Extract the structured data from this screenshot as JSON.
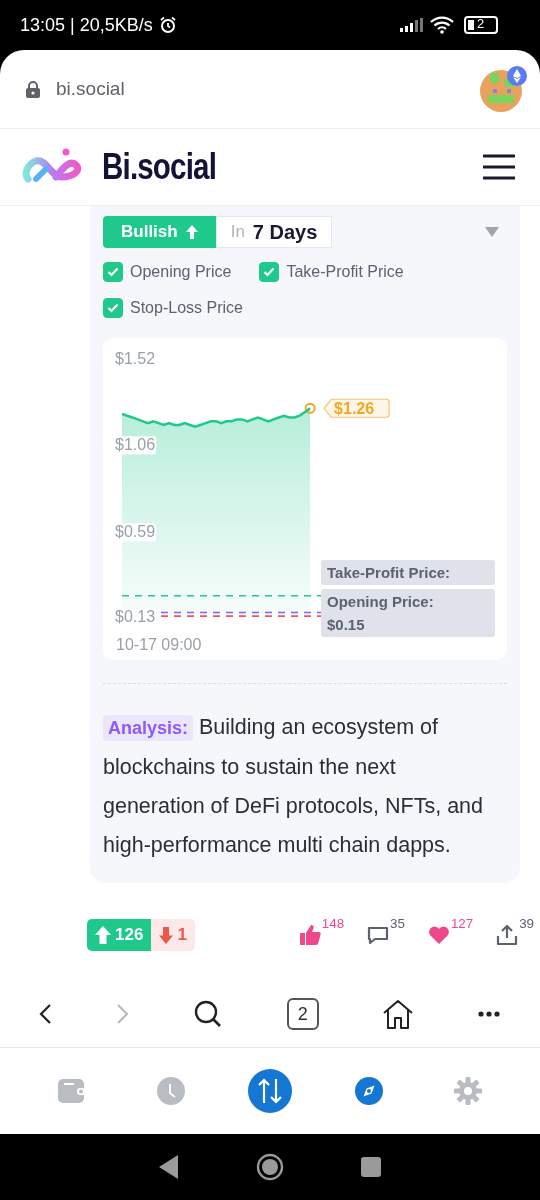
{
  "status_bar": {
    "time": "13:05 | 20,5KB/s",
    "battery": "2"
  },
  "address_bar": {
    "url": "bi.social"
  },
  "site_header": {
    "logo": "Bi.social"
  },
  "prediction": {
    "direction": "Bullish",
    "period_prefix": "In",
    "period": "7 Days"
  },
  "toggles": [
    {
      "label": "Opening Price",
      "checked": true
    },
    {
      "label": "Take-Profit Price",
      "checked": true
    },
    {
      "label": "Stop-Loss Price",
      "checked": true
    }
  ],
  "chart": {
    "chart_data": {
      "type": "area",
      "ylim": [
        0.13,
        1.52
      ],
      "yticks": [
        {
          "value": 1.52,
          "label": "$1.52"
        },
        {
          "value": 1.06,
          "label": "$1.06"
        },
        {
          "value": 0.59,
          "label": "$0.59"
        },
        {
          "value": 0.13,
          "label": "$0.13"
        }
      ],
      "series": [
        {
          "color": "#1ec98b",
          "values": [
            1.23,
            1.22,
            1.21,
            1.2,
            1.19,
            1.18,
            1.19,
            1.18,
            1.17,
            1.18,
            1.17,
            1.17,
            1.18,
            1.17,
            1.16,
            1.17,
            1.18,
            1.19,
            1.19,
            1.18,
            1.19,
            1.19,
            1.2,
            1.2,
            1.19,
            1.2,
            1.21,
            1.2,
            1.19,
            1.2,
            1.21,
            1.22,
            1.21,
            1.21,
            1.22,
            1.24,
            1.26,
            null,
            null,
            null,
            null,
            null,
            null,
            null,
            null,
            null,
            null,
            null,
            null,
            null,
            null,
            null,
            null,
            null,
            null,
            null,
            null,
            null,
            null,
            null,
            null,
            null,
            null,
            null,
            null,
            null,
            null,
            null,
            null,
            null,
            null,
            null
          ]
        }
      ],
      "ref_lines": [
        {
          "axis": "y",
          "value": 0.25,
          "color": "#1ec98b"
        },
        {
          "axis": "y",
          "value": 0.16,
          "color": "#8b5cf6"
        },
        {
          "axis": "y",
          "value": 0.14,
          "color": "#f0556a"
        }
      ]
    },
    "start_time": "10-17 09:00",
    "current_price": "$1.26",
    "tooltips": [
      {
        "title": "Take-Profit Price:"
      },
      {
        "title": "Opening Price:",
        "value": "$0.15"
      }
    ]
  },
  "analysis": {
    "tag": "Analysis:",
    "text": "Building an ecosystem of blockchains to sustain the next generation of DeFi protocols, NFTs, and high-performance multi chain dapps."
  },
  "votes": {
    "up": "126",
    "down": "1"
  },
  "stats": [
    {
      "count": "148",
      "active": true
    },
    {
      "count": "35",
      "active": false
    },
    {
      "count": "127",
      "active": true
    },
    {
      "count": "39",
      "active": false
    }
  ],
  "browser_toolbar": {
    "tab_count": "2",
    "forward_disabled": true
  },
  "bottom_nav": [
    {
      "kind": "tab",
      "selected": false
    },
    {
      "kind": "tab",
      "selected": false
    },
    {
      "kind": "action",
      "selected": false
    },
    {
      "kind": "tab",
      "selected": true
    },
    {
      "kind": "tab",
      "selected": false
    }
  ]
}
